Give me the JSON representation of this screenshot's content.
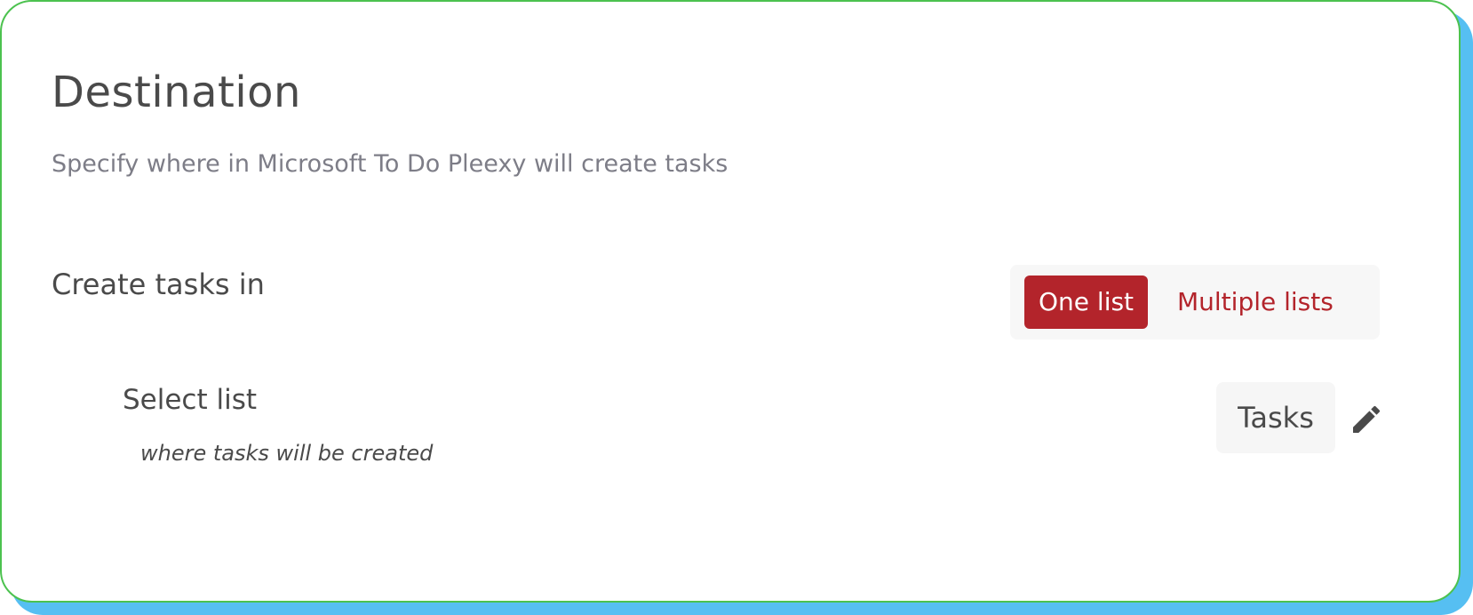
{
  "section": {
    "title": "Destination",
    "subtitle": "Specify where in Microsoft To Do Pleexy will create tasks"
  },
  "create_tasks": {
    "label": "Create tasks in",
    "options": [
      {
        "label": "One list",
        "selected": true
      },
      {
        "label": "Multiple lists",
        "selected": false
      }
    ]
  },
  "select_list": {
    "label": "Select list",
    "hint": "where tasks will be created",
    "value": "Tasks",
    "edit_icon": "pencil-icon"
  },
  "colors": {
    "accent": "#b3242b",
    "border": "#4cc24f",
    "shadow": "#56bff2"
  }
}
